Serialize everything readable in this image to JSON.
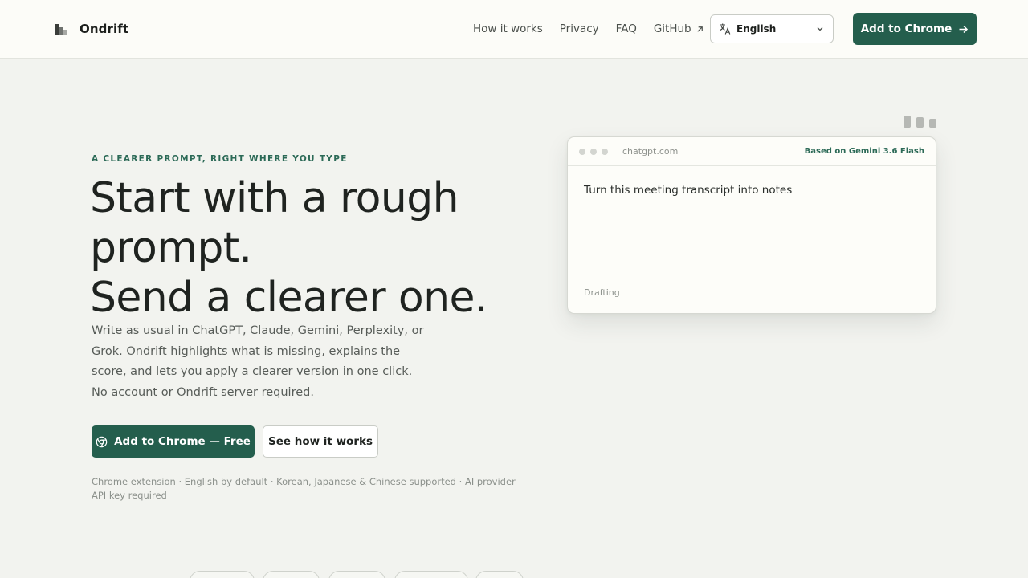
{
  "header": {
    "brand": "Ondrift",
    "nav": [
      "How it works",
      "Privacy",
      "FAQ"
    ],
    "github_label": "GitHub",
    "github_icon": "external-arrow-icon",
    "language": "English",
    "add_button": "Add to Chrome"
  },
  "hero": {
    "eyebrow": "A CLEARER PROMPT, RIGHT WHERE YOU TYPE",
    "headline_lines": [
      "Start with a rough",
      "prompt.",
      "Send a clearer one."
    ],
    "lead_lines": [
      "Write as usual in ChatGPT, Claude, Gemini, Perplexity, or",
      "Grok. Ondrift highlights what is missing, explains the",
      "score, and lets you apply a clearer version in one click.",
      "No account or Ondrift server required."
    ],
    "primary_cta": "Add to Chrome — Free",
    "secondary_cta": "See how it works",
    "footnote": "Chrome extension · English by default · Korean, Japanese & Chinese supported · AI provider API key required"
  },
  "preview": {
    "domain": "chatgpt.com",
    "model_badge": "Based on Gemini 3.6 Flash",
    "prompt_text": "Turn this meeting transcript into notes",
    "status": "Drafting"
  },
  "colors": {
    "accent": "#245e4d",
    "background": "#f2f3ef",
    "header_bg": "#fcfcf8"
  }
}
